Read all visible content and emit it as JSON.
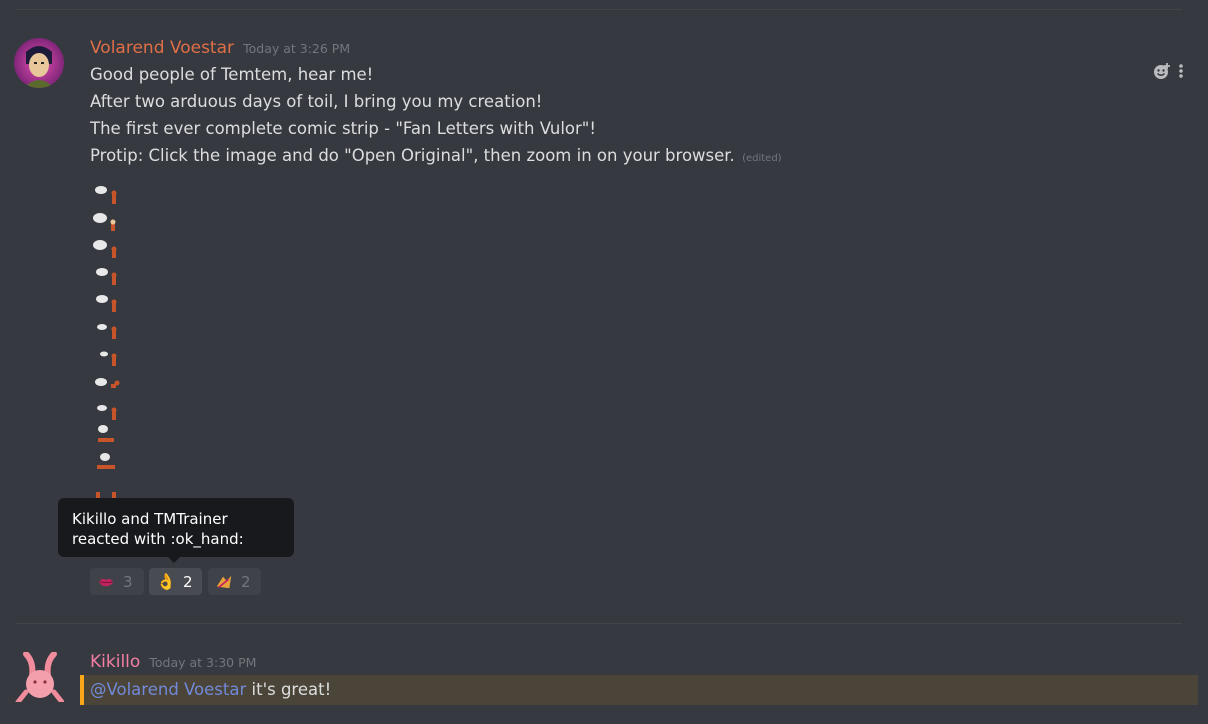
{
  "messages": [
    {
      "author": "Volarend Voestar",
      "author_color": "#e06f47",
      "timestamp": "Today at 3:26 PM",
      "lines": [
        "Good people of Temtem, hear me!",
        "After two arduous days of toil, I bring you my creation!",
        "The first ever complete comic strip - \"Fan Letters with Vulor\"!",
        "Protip: Click the image and do \"Open Original\", then zoom in on your browser."
      ],
      "edited_label": "(edited)",
      "reactions": [
        {
          "emoji": "lips-emoji",
          "count": "3"
        },
        {
          "emoji": "ok-hand-emoji",
          "glyph": "👌",
          "count": "2"
        },
        {
          "emoji": "temtem-emoji",
          "count": "2"
        }
      ],
      "tooltip": {
        "line1": "Kikillo and TMTrainer",
        "line2": "reacted with :ok_hand:"
      }
    },
    {
      "author": "Kikillo",
      "author_color": "#f47fa3",
      "timestamp": "Today at 3:30 PM",
      "mention": "@Volarend Voestar",
      "text": " it's great!",
      "highlight_color": "#faa81a"
    }
  ]
}
